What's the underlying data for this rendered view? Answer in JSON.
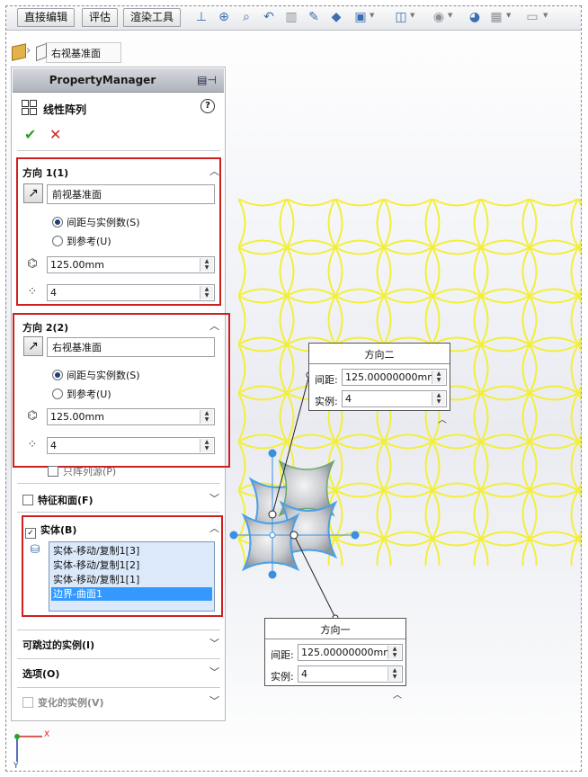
{
  "toolbar": {
    "tabs": [
      "直接编辑",
      "评估",
      "渲染工具"
    ],
    "icons": [
      "view-orientation-icon",
      "zoom-fit-icon",
      "zoom-area-icon",
      "previous-view-icon",
      "section-view-icon",
      "dynamic-annotation-icon",
      "view-cube-icon",
      "display-style-icon",
      "hide-show-icon",
      "edit-appearance-icon",
      "apply-scene-icon",
      "view-settings-icon",
      "monitor-icon"
    ]
  },
  "breadcrumb": {
    "label": "右视基准面"
  },
  "pm": {
    "header": "PropertyManager",
    "feature_title": "线性阵列",
    "help": "?",
    "ok": "✔",
    "cancel": "✕",
    "dir1": {
      "title": "方向 1(1)",
      "reference": "前视基准面",
      "opt_spacing": "间距与实例数(S)",
      "opt_upto": "到参考(U)",
      "spacing": "125.00mm",
      "count": "4",
      "spacing_icon_label": "D1"
    },
    "dir2": {
      "title": "方向 2(2)",
      "reference": "右视基准面",
      "opt_spacing": "间距与实例数(S)",
      "opt_upto": "到参考(U)",
      "spacing": "125.00mm",
      "count": "4",
      "spacing_icon_label": "D2",
      "seed_only": "只阵列源(P)"
    },
    "features_faces": "特征和面(F)",
    "bodies": {
      "title": "实体(B)",
      "items": [
        "实体-移动/复制1[3]",
        "实体-移动/复制1[2]",
        "实体-移动/复制1[1]",
        "边界-曲面1"
      ]
    },
    "skip_instances": "可跳过的实例(I)",
    "options": "选项(O)",
    "varied_instances": "变化的实例(V)"
  },
  "callout_dir2": {
    "title": "方向二",
    "spacing_label": "间距:",
    "spacing": "125.00000000mm",
    "count_label": "实例:",
    "count": "4"
  },
  "callout_dir1": {
    "title": "方向一",
    "spacing_label": "间距:",
    "spacing": "125.00000000mm",
    "count_label": "实例:",
    "count": "4"
  },
  "triad": {
    "x": "X",
    "y": "Y"
  },
  "colors": {
    "pattern": "#f2ef3a",
    "accent": "#3399ff",
    "highlight_box": "#d01f1f"
  }
}
